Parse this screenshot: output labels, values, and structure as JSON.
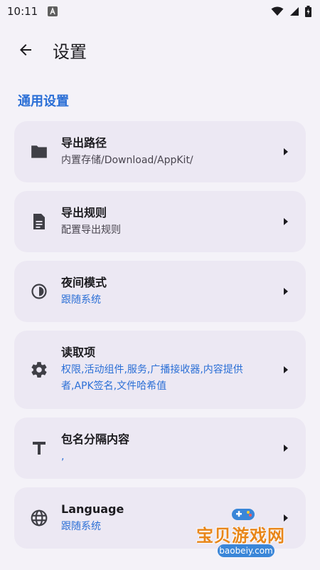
{
  "status_bar": {
    "time": "10:11"
  },
  "app_bar": {
    "title": "设置"
  },
  "section": {
    "title": "通用设置"
  },
  "items": [
    {
      "title": "导出路径",
      "subtitle": "内置存储/Download/AppKit/",
      "icon": "folder-icon"
    },
    {
      "title": "导出规则",
      "subtitle": "配置导出规则",
      "icon": "document-icon"
    },
    {
      "title": "夜间模式",
      "subtitle": "跟随系统",
      "icon": "half-circle-icon"
    },
    {
      "title": "读取项",
      "subtitle": "权限,活动组件,服务,广播接收器,内容提供者,APK签名,文件哈希值",
      "icon": "gear-icon"
    },
    {
      "title": "包名分隔内容",
      "subtitle": ",",
      "icon": "text-t-icon"
    },
    {
      "title": "Language",
      "subtitle": "跟随系统",
      "icon": "globe-icon"
    }
  ],
  "watermark": {
    "name": "宝贝游戏网",
    "url": "baobeiy.com"
  },
  "colors": {
    "accent": "#2b6fd6",
    "card_bg": "#ece8f3",
    "page_bg": "#f4f2f8"
  }
}
